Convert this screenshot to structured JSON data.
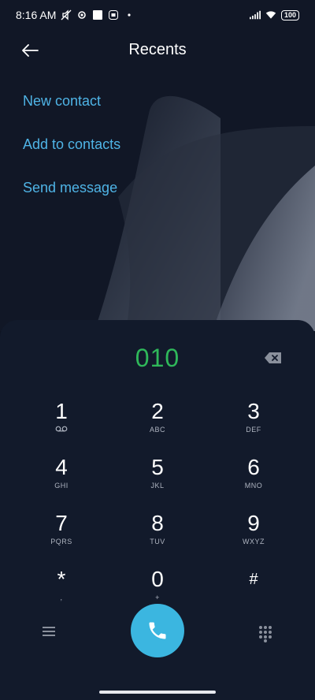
{
  "status_bar": {
    "time": "8:16 AM",
    "battery": "100",
    "icons": [
      "mute-icon",
      "settings-icon",
      "square-icon",
      "app-icon",
      "dot-icon",
      "signal-icon",
      "wifi-icon",
      "battery-icon"
    ]
  },
  "header": {
    "title": "Recents",
    "back_icon": "back-arrow-icon"
  },
  "actions": {
    "new_contact": "New contact",
    "add_to_contacts": "Add to contacts",
    "send_message": "Send message"
  },
  "dialpad": {
    "number": "010",
    "keys": [
      {
        "digit": "1",
        "letters": "",
        "icon": "voicemail-icon"
      },
      {
        "digit": "2",
        "letters": "ABC"
      },
      {
        "digit": "3",
        "letters": "DEF"
      },
      {
        "digit": "4",
        "letters": "GHI"
      },
      {
        "digit": "5",
        "letters": "JKL"
      },
      {
        "digit": "6",
        "letters": "MNO"
      },
      {
        "digit": "7",
        "letters": "PQRS"
      },
      {
        "digit": "8",
        "letters": "TUV"
      },
      {
        "digit": "9",
        "letters": "WXYZ"
      },
      {
        "digit": "*",
        "letters": ","
      },
      {
        "digit": "0",
        "letters": "+"
      },
      {
        "digit": "#",
        "letters": ""
      }
    ]
  },
  "colors": {
    "background": "#0f1524",
    "accent": "#4fb4e6",
    "number": "#2fb85a",
    "call_button": "#3bb6e0"
  }
}
